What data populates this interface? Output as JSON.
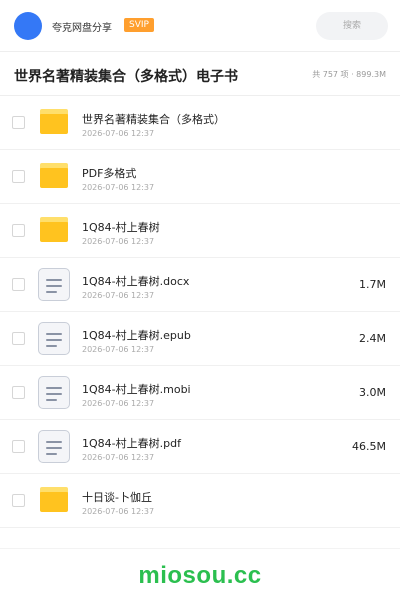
{
  "header": {
    "username": "夸克网盘分享",
    "badge": "SVIP",
    "search_placeholder": "搜索"
  },
  "share": {
    "title": "世界名著精装集合（多格式）电子书",
    "summary": "共 757 项 · 899.3M"
  },
  "files": [
    {
      "type": "folder",
      "icon": "folder-icon",
      "name": "世界名著精装集合（多格式）",
      "date": "2026-07-06 12:37",
      "size": ""
    },
    {
      "type": "folder",
      "icon": "folder-icon",
      "name": "PDF多格式",
      "date": "2026-07-06 12:37",
      "size": ""
    },
    {
      "type": "folder",
      "icon": "folder-icon",
      "name": "1Q84-村上春树",
      "date": "2026-07-06 12:37",
      "size": ""
    },
    {
      "type": "file",
      "icon": "document-icon",
      "name": "1Q84-村上春树.docx",
      "date": "2026-07-06 12:37",
      "size": "1.7M"
    },
    {
      "type": "file",
      "icon": "document-icon",
      "name": "1Q84-村上春树.epub",
      "date": "2026-07-06 12:37",
      "size": "2.4M"
    },
    {
      "type": "file",
      "icon": "document-icon",
      "name": "1Q84-村上春树.mobi",
      "date": "2026-07-06 12:37",
      "size": "3.0M"
    },
    {
      "type": "file",
      "icon": "document-icon",
      "name": "1Q84-村上春树.pdf",
      "date": "2026-07-06 12:37",
      "size": "46.5M"
    },
    {
      "type": "folder",
      "icon": "folder-icon",
      "name": "十日谈-卜伽丘",
      "date": "2026-07-06 12:37",
      "size": ""
    }
  ],
  "watermark": "miosou.cc",
  "colors": {
    "avatar": "#3478f6",
    "badge": "#ff9f2e",
    "folder": "#ffc31f",
    "watermark": "#2bbf4f"
  }
}
